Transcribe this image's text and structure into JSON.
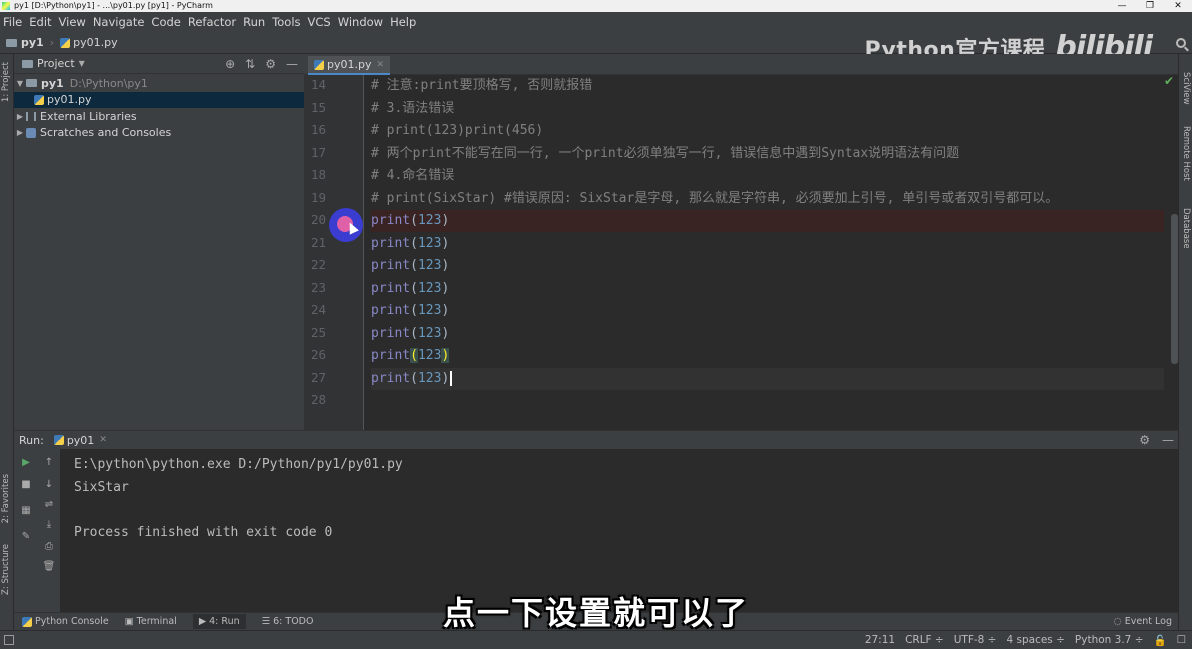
{
  "window": {
    "title": "py1 [D:\\Python\\py1] - ...\\py01.py [py1] - PyCharm",
    "controls": [
      "—",
      "❐",
      "✕"
    ]
  },
  "menu": [
    "File",
    "Edit",
    "View",
    "Navigate",
    "Code",
    "Refactor",
    "Run",
    "Tools",
    "VCS",
    "Window",
    "Help"
  ],
  "breadcrumb": {
    "project": "py1",
    "file": "py01.py"
  },
  "watermark": {
    "text": "Python官方课程",
    "logo": "bilibili"
  },
  "project_panel": {
    "title": "Project",
    "tree": [
      {
        "name": "py1",
        "path": "D:\\Python\\py1"
      },
      {
        "name": "py01.py"
      },
      {
        "name": "External Libraries"
      },
      {
        "name": "Scratches and Consoles"
      }
    ]
  },
  "side_labels": {
    "left": [
      "1: Project",
      "2: Favorites",
      "Z: Structure"
    ],
    "right": [
      "SciView",
      "Remote Host",
      "Database"
    ]
  },
  "editor": {
    "tab": "py01.py",
    "line_numbers": [
      "14",
      "15",
      "16",
      "17",
      "18",
      "19",
      "20",
      "21",
      "22",
      "23",
      "24",
      "25",
      "26",
      "27",
      "28"
    ],
    "comments": {
      "l14": "# 注意:print要顶格写, 否则就报错",
      "l15": "# 3.语法错误",
      "l16": "# print(123)print(456)",
      "l17": "# 两个print不能写在同一行, 一个print必须单独写一行, 错误信息中遇到Syntax说明语法有问题",
      "l18": "# 4.命名错误",
      "l19": "# print(SixStar)   #错误原因: SixStar是字母, 那么就是字符串, 必须要加上引号, 单引号或者双引号都可以。"
    },
    "code_fn": "print",
    "code_num": "123",
    "paren_open": "(",
    "paren_close": ")",
    "breakpoint_line": 20,
    "caret": "27:11"
  },
  "run_panel": {
    "label": "Run:",
    "tab": "py01",
    "console": [
      "E:\\python\\python.exe D:/Python/py1/py01.py",
      "SixStar",
      "",
      "Process finished with exit code 0"
    ]
  },
  "subtitle": "点一下设置就可以了",
  "bottom_tabs": [
    "Python Console",
    "Terminal",
    "4: Run",
    "6: TODO"
  ],
  "event_log": "Event Log",
  "status": {
    "position": "27:11",
    "line_sep": "CRLF ÷",
    "encoding": "UTF-8 ÷",
    "indent": "4 spaces ÷",
    "interpreter": "Python 3.7 ÷"
  }
}
